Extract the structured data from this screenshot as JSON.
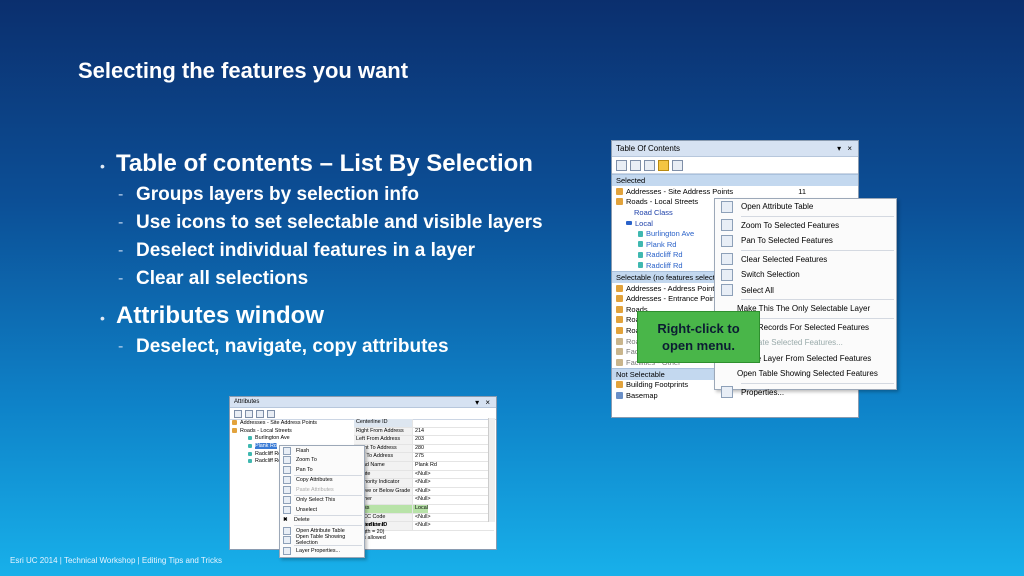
{
  "slide": {
    "title": "Selecting the features you want",
    "footer": "Esri UC 2014 | Technical Workshop | Editing Tips and Tricks"
  },
  "bullets": [
    {
      "text": "Table of contents – List By Selection",
      "subs": [
        "Groups layers by selection info",
        "Use icons to set selectable and visible layers",
        "Deselect individual features in a layer",
        "Clear all selections"
      ]
    },
    {
      "text": "Attributes window",
      "subs": [
        "Deselect, navigate, copy attributes"
      ]
    }
  ],
  "toc": {
    "title": "Table Of Contents",
    "controls": "▾ ×",
    "selected_header": "Selected",
    "rows_selected": [
      "Addresses - Site Address Points",
      "Roads - Local Streets"
    ],
    "count_site": "11",
    "count_building": "0",
    "road_class": "Road Class",
    "local": "Local",
    "streets": [
      "Burlington Ave",
      "Plank Rd",
      "Radcliff Rd",
      "Radcliff Rd"
    ],
    "selectable_header": "Selectable (no features selected)",
    "rows_selectable": [
      "Addresses - Address Points",
      "Addresses - Entrance Points",
      "Roads",
      "Roads",
      "Roads",
      "Roads",
      "Facilities",
      "Facilities - Other"
    ],
    "not_selectable_header": "Not Selectable",
    "rows_not_selectable": [
      "Building Footprints",
      "Basemap"
    ]
  },
  "toc_menu": {
    "items": [
      "Open Attribute Table",
      "Zoom To Selected Features",
      "Pan To Selected Features",
      "Clear Selected Features",
      "Switch Selection",
      "Select All",
      "Make This The Only Selectable Layer",
      "Copy Records For Selected Features",
      "Annotate Selected Features...",
      "Create Layer From Selected Features",
      "Open Table Showing Selected Features",
      "Properties..."
    ]
  },
  "callout": {
    "line1": "Right-click to",
    "line2": "open menu."
  },
  "attributes": {
    "title": "Attributes",
    "controls": "▾ ×",
    "tree": [
      "Addresses - Site Address Points",
      "Roads - Local Streets",
      "Burlington Ave",
      "Plank Rd",
      "Radcliff Rd",
      "Radcliff Rd"
    ],
    "grid": [
      [
        "Centerline ID",
        ""
      ],
      [
        "Right From Address",
        "214"
      ],
      [
        "Left From Address",
        "203"
      ],
      [
        "Right To Address",
        "280"
      ],
      [
        "Left To Address",
        "275"
      ],
      [
        "Road Name",
        "Plank Rd"
      ],
      [
        "Route",
        "<Null>"
      ],
      [
        "Authority Indicator",
        "<Null>"
      ],
      [
        "Above or Below Grade",
        "<Null>"
      ],
      [
        "Owner",
        "<Null>"
      ],
      [
        "Class",
        "Local"
      ],
      [
        "CFCC Code",
        "<Null>"
      ],
      [
        "Speed Limit",
        "<Null>"
      ]
    ],
    "info": [
      "Centerline ID",
      "(length = 20)",
      "Nulls allowed"
    ]
  },
  "attr_menu": {
    "items": [
      "Flash",
      "Zoom To",
      "Pan To",
      "Copy Attributes",
      "Paste Attributes",
      "Only Select This",
      "Unselect",
      "Delete",
      "Open Attribute Table",
      "Open Table Showing Selection",
      "Layer Properties..."
    ]
  }
}
